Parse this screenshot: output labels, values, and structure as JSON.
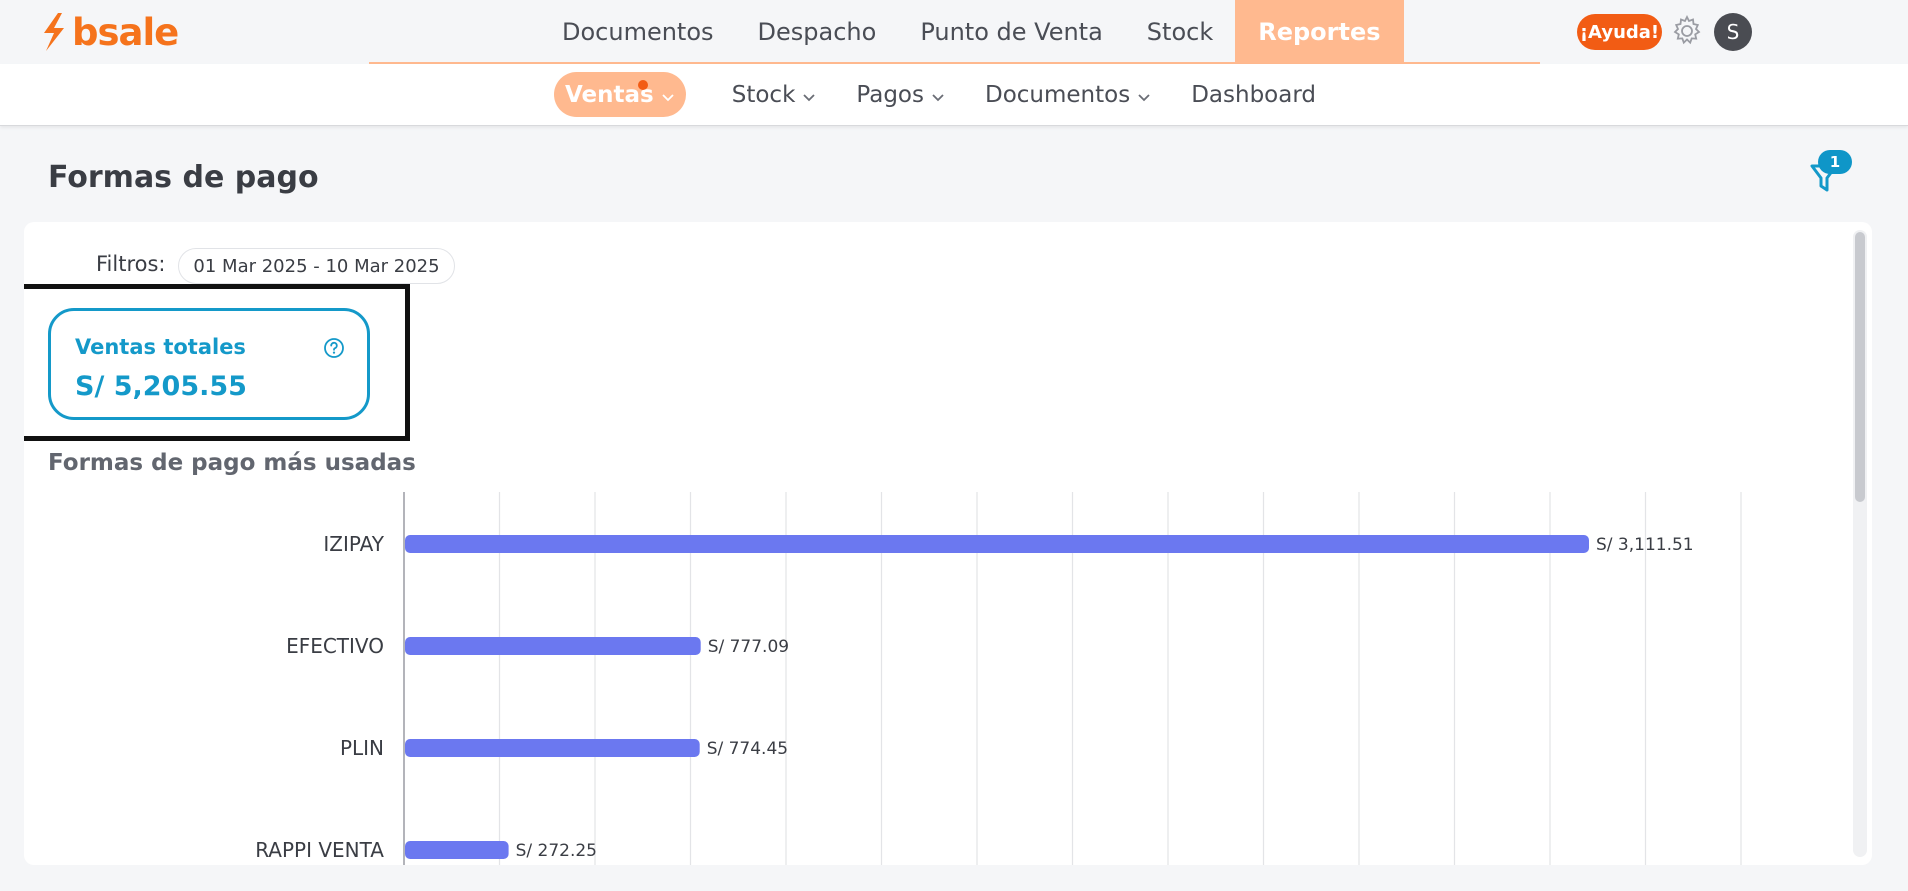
{
  "brand": {
    "name": "bsale",
    "color": "#f5731c"
  },
  "main_nav": [
    {
      "label": "Documentos",
      "active": false
    },
    {
      "label": "Despacho",
      "active": false
    },
    {
      "label": "Punto de Venta",
      "active": false
    },
    {
      "label": "Stock",
      "active": false
    },
    {
      "label": "Reportes",
      "active": true
    }
  ],
  "header_actions": {
    "help_label": "¡Ayuda!",
    "settings_icon": "gear-icon",
    "avatar_initial": "S"
  },
  "sub_nav": [
    {
      "label": "Ventas",
      "active": true,
      "has_dropdown": true,
      "has_notification": true
    },
    {
      "label": "Stock",
      "active": false,
      "has_dropdown": true
    },
    {
      "label": "Pagos",
      "active": false,
      "has_dropdown": true
    },
    {
      "label": "Documentos",
      "active": false,
      "has_dropdown": true
    },
    {
      "label": "Dashboard",
      "active": false,
      "has_dropdown": false
    }
  ],
  "page": {
    "title": "Formas de pago",
    "filter_count": "1"
  },
  "filters": {
    "label": "Filtros:",
    "date_range": "01 Mar 2025 - 10 Mar 2025"
  },
  "kpi": {
    "label": "Ventas totales",
    "value": "S/ 5,205.55",
    "help_icon": "help-circle-icon"
  },
  "chart_title": "Formas de pago más usadas",
  "colors": {
    "accent": "#1499c9",
    "orange": "#f25c14",
    "bar": "#6b78f0",
    "nav_active": "#ffb98f"
  },
  "chart_data": {
    "type": "bar",
    "orientation": "horizontal",
    "title": "Formas de pago más usadas",
    "categories": [
      "IZIPAY",
      "EFECTIVO",
      "PLIN",
      "RAPPI VENTA"
    ],
    "values": [
      3111.51,
      777.09,
      774.45,
      272.25
    ],
    "value_labels": [
      "S/ 3,111.51",
      "S/ 777.09",
      "S/ 774.45",
      "S/ 272.25"
    ],
    "xlim": [
      0,
      3500
    ],
    "grid": true
  }
}
